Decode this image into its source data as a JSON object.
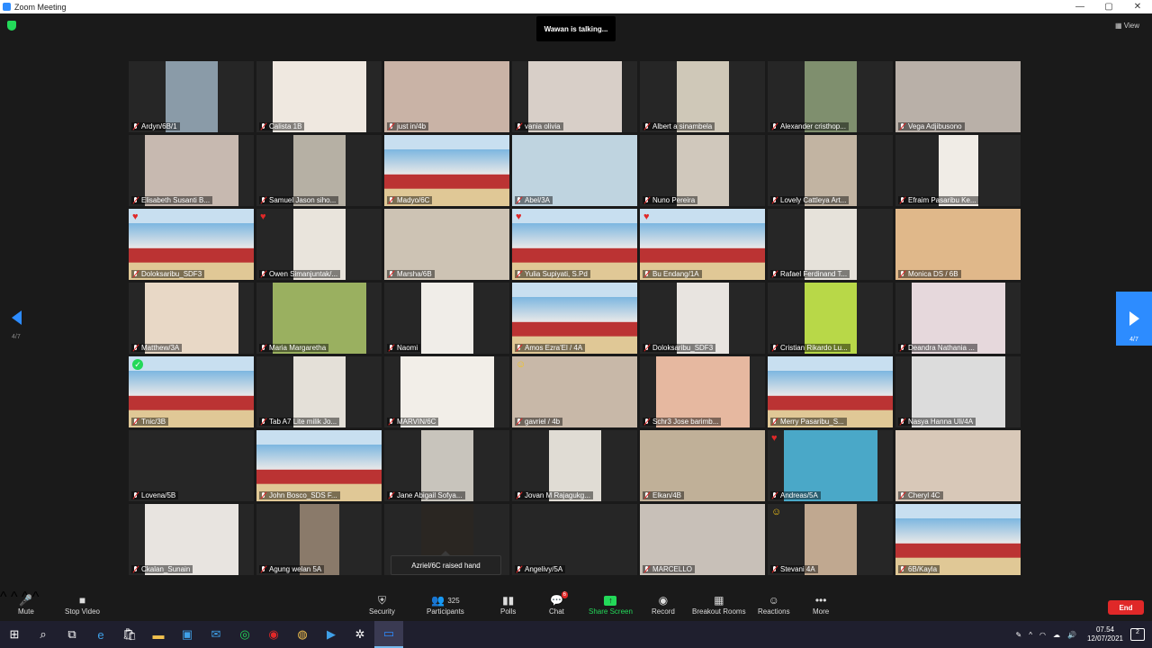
{
  "window": {
    "title": "Zoom Meeting",
    "min": "—",
    "max": "▢",
    "close": "✕"
  },
  "header": {
    "talking": "Wawan is talking...",
    "view_label": "View"
  },
  "pager": {
    "left_label": "4/7",
    "right_label": "4/7"
  },
  "toast": {
    "raised_hand": "Azriel/6C raised hand"
  },
  "colors": {
    "accent": "#2d8cff",
    "end": "#e02828",
    "share": "#23d959"
  },
  "participants": [
    {
      "name": "Ardyn/6B/1",
      "video": "c",
      "w": 58,
      "bg": "#8a9ba8",
      "reaction": ""
    },
    {
      "name": "Calista 1B",
      "video": "c",
      "w": 104,
      "bg": "#efe8e0",
      "reaction": ""
    },
    {
      "name": "just in/4b",
      "video": "f",
      "w": 0,
      "bg": "#c9b3a6",
      "reaction": ""
    },
    {
      "name": "vania olivia",
      "video": "c",
      "w": 104,
      "bg": "#d8cfc8",
      "reaction": ""
    },
    {
      "name": "Albert a sinambela",
      "video": "c",
      "w": 58,
      "bg": "#cfc8b8",
      "reaction": ""
    },
    {
      "name": "Alexander cristhop...",
      "video": "c",
      "w": 58,
      "bg": "#7f8f6e",
      "reaction": ""
    },
    {
      "name": "Vega Adjibusono",
      "video": "f",
      "w": 0,
      "bg": "#b9b0a8",
      "reaction": ""
    },
    {
      "name": "Elisabeth Susanti B...",
      "video": "c",
      "w": 104,
      "bg": "#c7b9b0",
      "reaction": ""
    },
    {
      "name": "Samuel Jason siho...",
      "video": "c",
      "w": 58,
      "bg": "#b6b0a4",
      "reaction": ""
    },
    {
      "name": "Madyo/6C",
      "video": "banner",
      "w": 0,
      "bg": "",
      "reaction": ""
    },
    {
      "name": "Abel/3A",
      "video": "f",
      "w": 0,
      "bg": "#bfd4e0",
      "reaction": ""
    },
    {
      "name": "Nuno Pereira",
      "video": "c",
      "w": 58,
      "bg": "#d0c8bc",
      "reaction": ""
    },
    {
      "name": "Lovely Cattleya Art...",
      "video": "c",
      "w": 58,
      "bg": "#c2b4a2",
      "reaction": ""
    },
    {
      "name": "Efraim Pasaribu Ke...",
      "video": "c",
      "w": 44,
      "bg": "#f0ece6",
      "reaction": ""
    },
    {
      "name": "Doloksaribu_SDF3",
      "video": "banner",
      "w": 0,
      "bg": "",
      "reaction": "heart"
    },
    {
      "name": "Owen Simanjuntak/...",
      "video": "c",
      "w": 58,
      "bg": "#e9e4dc",
      "reaction": "heart"
    },
    {
      "name": "Marsha/6B",
      "video": "f",
      "w": 0,
      "bg": "#cdc3b4",
      "reaction": ""
    },
    {
      "name": "Yulia Supiyati, S.Pd",
      "video": "banner",
      "w": 0,
      "bg": "",
      "reaction": "heart"
    },
    {
      "name": "Bu Endang/1A",
      "video": "banner",
      "w": 0,
      "bg": "",
      "reaction": "heart"
    },
    {
      "name": "Rafael Ferdinand T...",
      "video": "c",
      "w": 58,
      "bg": "#e6e2da",
      "reaction": ""
    },
    {
      "name": "Monica DS / 6B",
      "video": "f",
      "w": 0,
      "bg": "#e0b88a",
      "reaction": ""
    },
    {
      "name": "Matthew/3A",
      "video": "c",
      "w": 104,
      "bg": "#e8d8c6",
      "reaction": ""
    },
    {
      "name": "Maria Margaretha",
      "video": "c",
      "w": 104,
      "bg": "#9ab060",
      "reaction": ""
    },
    {
      "name": "Naomi",
      "video": "c",
      "w": 58,
      "bg": "#f0ede8",
      "reaction": ""
    },
    {
      "name": "Amos Ezra'El / 4A",
      "video": "banner",
      "w": 0,
      "bg": "",
      "reaction": ""
    },
    {
      "name": "Doloksaribu_SDF3",
      "video": "c",
      "w": 58,
      "bg": "#e8e4e0",
      "reaction": ""
    },
    {
      "name": "Cristian Rikardo Lu...",
      "video": "c",
      "w": 58,
      "bg": "#b8d848",
      "reaction": ""
    },
    {
      "name": "Deandra Nathania ...",
      "video": "c",
      "w": 104,
      "bg": "#e6d8dc",
      "reaction": ""
    },
    {
      "name": "Tnic/3B",
      "video": "banner",
      "w": 0,
      "bg": "",
      "reaction": "check"
    },
    {
      "name": "Tab A7 Lite milik Jo...",
      "video": "c",
      "w": 58,
      "bg": "#e4e0d8",
      "reaction": ""
    },
    {
      "name": "MARVIN/6C",
      "video": "c",
      "w": 104,
      "bg": "#f2eee8",
      "reaction": ""
    },
    {
      "name": "gavriel / 4b",
      "video": "f",
      "w": 0,
      "bg": "#c8b8a8",
      "reaction": "emo"
    },
    {
      "name": "Schr3 Jose barimb...",
      "video": "c",
      "w": 104,
      "bg": "#e6b8a0",
      "reaction": ""
    },
    {
      "name": "Merry Pasaribu_S...",
      "video": "banner",
      "w": 0,
      "bg": "",
      "reaction": ""
    },
    {
      "name": "Nasya Hanna Uli/4A",
      "video": "c",
      "w": 104,
      "bg": "#dcdcdc",
      "reaction": ""
    },
    {
      "name": "Lovena/5B",
      "video": "f",
      "w": 0,
      "bg": "#262626",
      "reaction": ""
    },
    {
      "name": "John Bosco_SDS F...",
      "video": "banner",
      "w": 0,
      "bg": "",
      "reaction": ""
    },
    {
      "name": "Jane Abigail Sofya...",
      "video": "c",
      "w": 58,
      "bg": "#c8c4bc",
      "reaction": ""
    },
    {
      "name": "Jovan M Rajagukg...",
      "video": "c",
      "w": 58,
      "bg": "#e0dcd4",
      "reaction": ""
    },
    {
      "name": "Elkan/4B",
      "video": "f",
      "w": 0,
      "bg": "#c0b098",
      "reaction": ""
    },
    {
      "name": "Andreas/5A",
      "video": "c",
      "w": 104,
      "bg": "#4aa8c8",
      "reaction": "heart"
    },
    {
      "name": "Cheryl 4C",
      "video": "f",
      "w": 0,
      "bg": "#d8c8b8",
      "reaction": ""
    },
    {
      "name": "Ckalan_Sunain",
      "video": "c",
      "w": 104,
      "bg": "#e8e4e0",
      "reaction": ""
    },
    {
      "name": "Agung welan 5A",
      "video": "c",
      "w": 44,
      "bg": "#8a7a6a",
      "reaction": ""
    },
    {
      "name": "",
      "video": "c",
      "w": 58,
      "bg": "#2a2622",
      "reaction": ""
    },
    {
      "name": "Angelivy/5A",
      "video": "f",
      "w": 0,
      "bg": "#262626",
      "reaction": ""
    },
    {
      "name": "MARCELLO",
      "video": "f",
      "w": 0,
      "bg": "#c8c0b8",
      "reaction": ""
    },
    {
      "name": "Stevani 4A",
      "video": "c",
      "w": 58,
      "bg": "#c0a890",
      "reaction": "emo"
    },
    {
      "name": "6B/Kayla",
      "video": "banner",
      "w": 0,
      "bg": "",
      "reaction": ""
    }
  ],
  "toolbar": {
    "mute": "Mute",
    "stop_video": "Stop Video",
    "security": "Security",
    "participants": "Participants",
    "participants_count": "325",
    "polls": "Polls",
    "chat": "Chat",
    "chat_badge": "6",
    "share_screen": "Share Screen",
    "record": "Record",
    "breakout": "Breakout Rooms",
    "reactions": "Reactions",
    "more": "More",
    "end": "End"
  },
  "taskbar": {
    "time": "07.54",
    "date": "12/07/2021",
    "notif_count": "2"
  }
}
